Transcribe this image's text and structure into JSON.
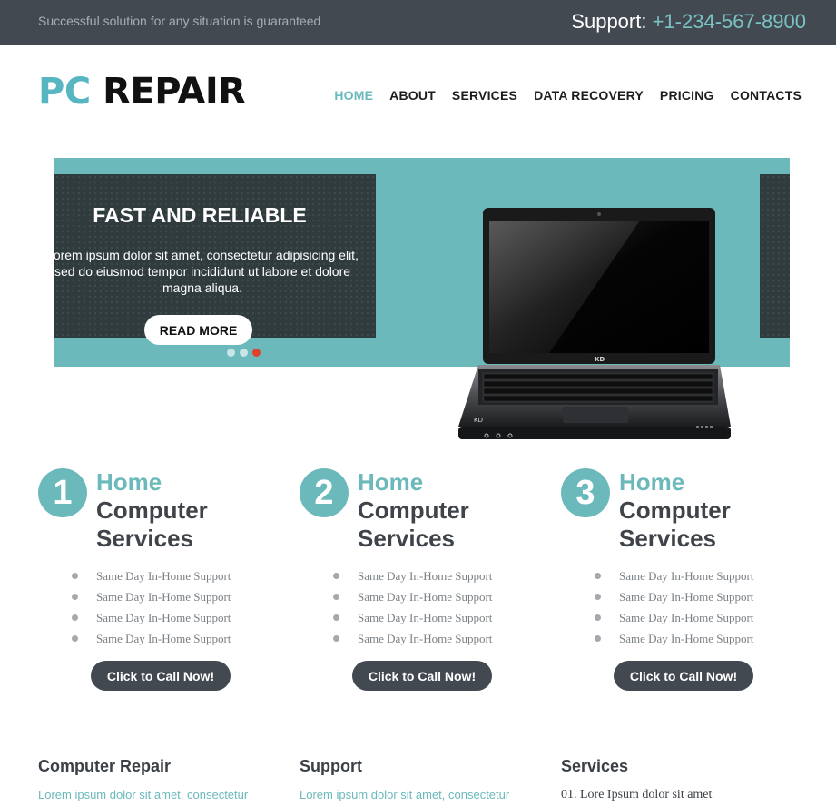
{
  "topbar": {
    "tagline": "Successful solution for any situation is guaranteed",
    "support_label": "Support: ",
    "support_phone": "+1-234-567-8900"
  },
  "header": {
    "logo_pc": "PC",
    "logo_repair": "REPAIR",
    "nav": [
      {
        "label": "HOME",
        "active": true
      },
      {
        "label": "ABOUT",
        "active": false
      },
      {
        "label": "SERVICES",
        "active": false
      },
      {
        "label": "DATA RECOVERY",
        "active": false
      },
      {
        "label": "PRICING",
        "active": false
      },
      {
        "label": "CONTACTS",
        "active": false
      }
    ]
  },
  "slider": {
    "title": "FAST AND RELIABLE",
    "text": "Lorem ipsum dolor sit amet, consectetur adipisicing elit, sed do eiusmod tempor incididunt ut labore et dolore magna aliqua.",
    "button": "READ MORE",
    "active_slide": 3,
    "slide_count": 3,
    "laptop_brand": "KD"
  },
  "features": [
    {
      "number": "1",
      "title_accent": "Home",
      "title_line2": "Computer",
      "title_line3": "Services",
      "items": [
        "Same Day In-Home Support",
        "Same Day In-Home Support",
        "Same Day In-Home Support",
        "Same Day In-Home Support"
      ],
      "button": "Click to Call Now!"
    },
    {
      "number": "2",
      "title_accent": "Home",
      "title_line2": "Computer",
      "title_line3": "Services",
      "items": [
        "Same Day In-Home Support",
        "Same Day In-Home Support",
        "Same Day In-Home Support",
        "Same Day In-Home Support"
      ],
      "button": "Click to Call Now!"
    },
    {
      "number": "3",
      "title_accent": "Home",
      "title_line2": "Computer",
      "title_line3": "Services",
      "items": [
        "Same Day In-Home Support",
        "Same Day In-Home Support",
        "Same Day In-Home Support",
        "Same Day In-Home Support"
      ],
      "button": "Click to Call Now!"
    }
  ],
  "bottom": {
    "repair": {
      "title": "Computer Repair",
      "text": "Lorem ipsum dolor sit amet, consectetur"
    },
    "support": {
      "title": "Support",
      "text": "Lorem ipsum dolor sit amet, consectetur"
    },
    "services": {
      "title": "Services",
      "item": "01. Lore Ipsum dolor sit amet"
    }
  },
  "colors": {
    "accent": "#6cb9bb",
    "dark": "#434950",
    "slide_dot_active": "#e0432b"
  }
}
